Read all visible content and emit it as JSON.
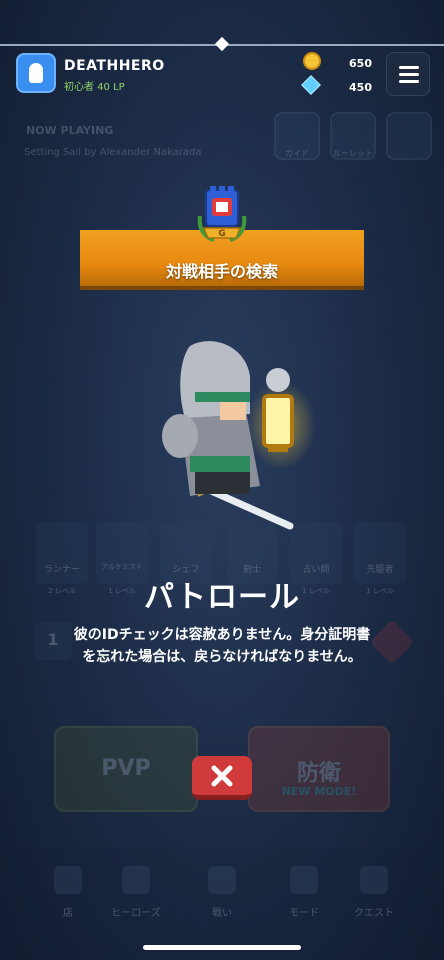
{
  "header": {
    "player_name": "DEATHHERO",
    "rank": "初心者 40 LP",
    "coins": "650",
    "gems": "450"
  },
  "background": {
    "now_playing": "NOW PLAYING",
    "song": "Setting Sail by Alexander Nakarada",
    "mini_buttons": [
      "ガイド",
      "ルーレット",
      ""
    ],
    "cards": [
      {
        "name": "ランナー",
        "level": "2 レベル"
      },
      {
        "name": "アルケミスト",
        "level": "1 レベル"
      },
      {
        "name": "シェフ",
        "level": ""
      },
      {
        "name": "剣士",
        "level": ""
      },
      {
        "name": "占い師",
        "level": "1 レベル"
      },
      {
        "name": "先駆者",
        "level": "1 レベル"
      }
    ],
    "side_left": "1",
    "pvp": "PVP",
    "defense": "防衛",
    "defense_mode": "NEW MODE!",
    "nav": [
      "店",
      "ヒーローズ",
      "戦い",
      "モード",
      "クエスト"
    ]
  },
  "modal": {
    "banner_title": "対戦相手の検索",
    "emblem_letter": "G",
    "enemy_name": "パトロール",
    "enemy_description": "彼のIDチェックは容赦ありません。身分証明書を忘れた場合は、戻らなければなりません。"
  },
  "colors": {
    "banner": "#e98a10",
    "close_button": "#d13a3a",
    "background": "#1a2740"
  }
}
